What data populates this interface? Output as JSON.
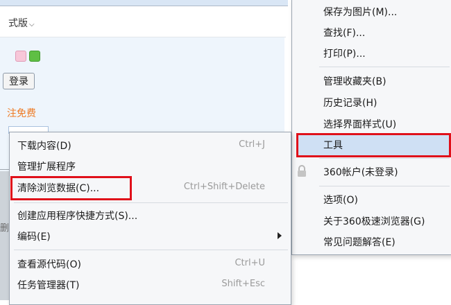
{
  "background_page": {
    "style_link": "式版",
    "login_button": "登录",
    "register_text": "注免费",
    "side_char": "删"
  },
  "main_menu": {
    "items": [
      {
        "label": "保存为图片(M)..."
      },
      {
        "label": "查找(F)..."
      },
      {
        "label": "打印(P)..."
      },
      {
        "label": "管理收藏夹(B)"
      },
      {
        "label": "历史记录(H)"
      },
      {
        "label": "选择界面样式(U)"
      },
      {
        "label": "工具"
      },
      {
        "label": "360帐户(未登录)"
      },
      {
        "label": "选项(O)"
      },
      {
        "label": "关于360极速浏览器(G)"
      },
      {
        "label": "常见问题解答(E)"
      }
    ]
  },
  "tools_submenu": {
    "items": [
      {
        "label": "下载内容(D)",
        "shortcut": "Ctrl+J"
      },
      {
        "label": "管理扩展程序",
        "shortcut": ""
      },
      {
        "label": "清除浏览数据(C)...",
        "shortcut": "Ctrl+Shift+Delete"
      },
      {
        "label": "创建应用程序快捷方式(S)...",
        "shortcut": ""
      },
      {
        "label": "编码(E)",
        "shortcut": ""
      },
      {
        "label": "查看源代码(O)",
        "shortcut": "Ctrl+U"
      },
      {
        "label": "任务管理器(T)",
        "shortcut": "Shift+Esc"
      }
    ]
  },
  "colors": {
    "highlight": "#cfe0f4",
    "annotation_red": "#e0101a",
    "link_orange": "#ee7a23"
  },
  "icons": [
    "chevron-down-icon",
    "lock-icon",
    "submenu-arrow-icon"
  ]
}
